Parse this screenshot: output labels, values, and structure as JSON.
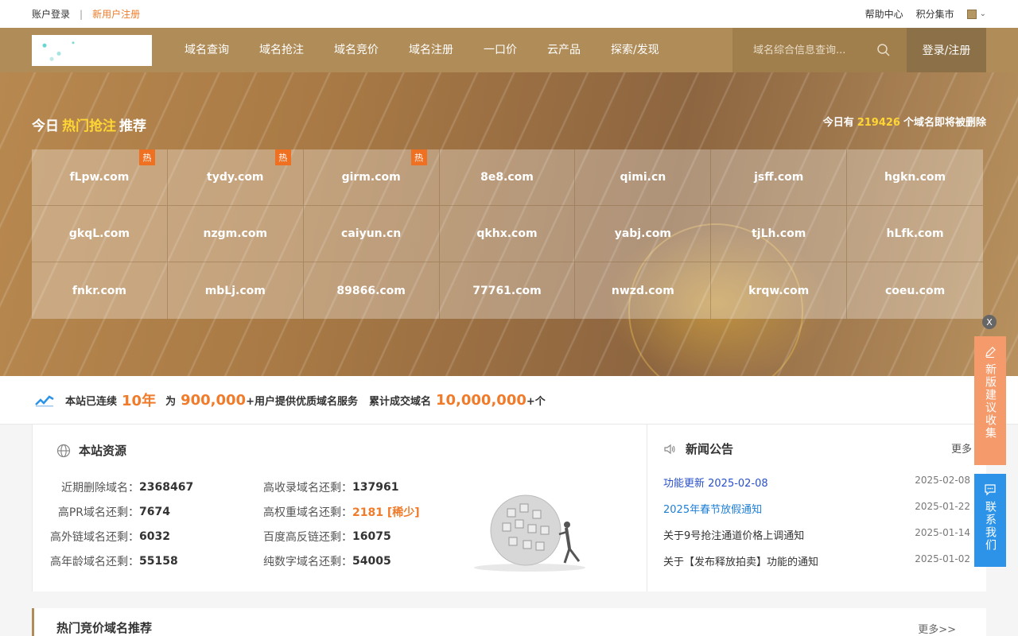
{
  "topbar": {
    "login": "账户登录",
    "register": "新用户注册",
    "help": "帮助中心",
    "points_mall": "积分集市"
  },
  "nav": {
    "menu": [
      "域名查询",
      "域名抢注",
      "域名竞价",
      "域名注册",
      "一口价",
      "云产品",
      "探索/发现"
    ],
    "search_placeholder": "域名综合信息查询...",
    "login_register": "登录/注册"
  },
  "hero": {
    "title_prefix": "今日",
    "title_hot": "热门抢注",
    "title_suffix": "推荐",
    "count_prefix": "今日有",
    "count_value": "219426",
    "count_suffix": "个域名即将被删除",
    "hot_badge": "热",
    "domains": [
      {
        "name": "fLpw.com",
        "hot": true
      },
      {
        "name": "tydy.com",
        "hot": true
      },
      {
        "name": "girm.com",
        "hot": true
      },
      {
        "name": "8e8.com",
        "hot": false
      },
      {
        "name": "qimi.cn",
        "hot": false
      },
      {
        "name": "jsff.com",
        "hot": false
      },
      {
        "name": "hgkn.com",
        "hot": false
      },
      {
        "name": "gkqL.com",
        "hot": false
      },
      {
        "name": "nzgm.com",
        "hot": false
      },
      {
        "name": "caiyun.cn",
        "hot": false
      },
      {
        "name": "qkhx.com",
        "hot": false
      },
      {
        "name": "yabj.com",
        "hot": false
      },
      {
        "name": "tjLh.com",
        "hot": false
      },
      {
        "name": "hLfk.com",
        "hot": false
      },
      {
        "name": "fnkr.com",
        "hot": false
      },
      {
        "name": "mbLj.com",
        "hot": false
      },
      {
        "name": "89866.com",
        "hot": false
      },
      {
        "name": "77761.com",
        "hot": false
      },
      {
        "name": "nwzd.com",
        "hot": false
      },
      {
        "name": "krqw.com",
        "hot": false
      },
      {
        "name": "coeu.com",
        "hot": false
      }
    ]
  },
  "stats": {
    "p1": "本站已连续",
    "years": "10年",
    "p2": "为",
    "users": "900,000",
    "p3": "+用户提供优质域名服务",
    "p4": "累计成交域名",
    "deals": "10,000,000",
    "p5": "+个"
  },
  "resources": {
    "title": "本站资源",
    "rows": [
      {
        "a_label": "近期删除域名：",
        "a_value": "2368467",
        "b_label": "高收录域名还剩：",
        "b_value": "137961",
        "b_orange": false
      },
      {
        "a_label": "高PR域名还剩：",
        "a_value": "7674",
        "b_label": "高权重域名还剩：",
        "b_value": "2181 [稀少]",
        "b_orange": true
      },
      {
        "a_label": "高外链域名还剩：",
        "a_value": "6032",
        "b_label": "百度高反链还剩：",
        "b_value": "16075",
        "b_orange": false
      },
      {
        "a_label": "高年龄域名还剩：",
        "a_value": "55158",
        "b_label": "纯数字域名还剩：",
        "b_value": "54005",
        "b_orange": false
      }
    ]
  },
  "news": {
    "title": "新闻公告",
    "more": "更多",
    "items": [
      {
        "title": "功能更新 2025-02-08",
        "date": "2025-02-08",
        "style": "blue"
      },
      {
        "title": "2025年春节放假通知",
        "date": "2025-01-22",
        "style": "lblue"
      },
      {
        "title": "关于9号抢注通道价格上调通知",
        "date": "2025-01-14",
        "style": ""
      },
      {
        "title": "关于【发布释放拍卖】功能的通知",
        "date": "2025-01-02",
        "style": ""
      }
    ]
  },
  "hot_auction": {
    "title": "热门竞价域名推荐",
    "more": "更多>>"
  },
  "float": {
    "close": "X",
    "feedback": "新版建议收集",
    "contact": "联系我们"
  },
  "colors": {
    "brand": "#b08d58",
    "accent_orange": "#f07b2a",
    "highlight_yellow": "#ffd633",
    "feedback_bg": "#f59a6a",
    "contact_bg": "#2c93e8"
  }
}
